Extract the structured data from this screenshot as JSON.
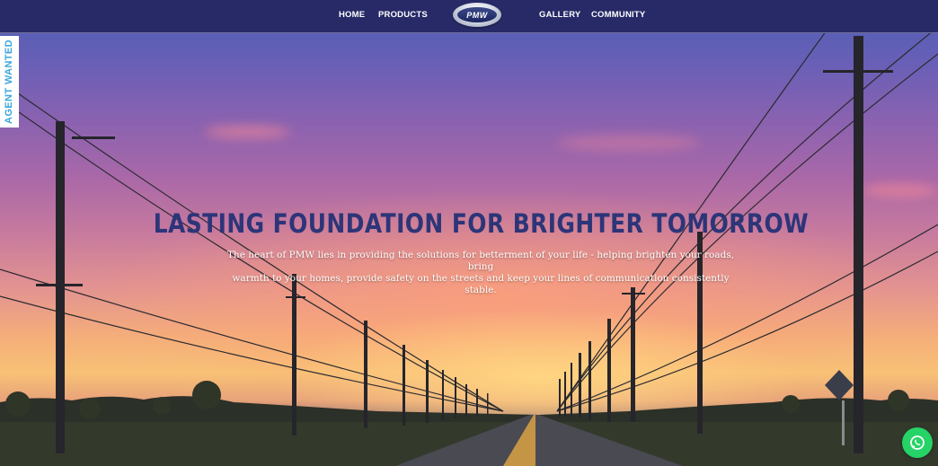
{
  "nav": {
    "home": "HOME",
    "products": "PRODUCTS",
    "logo_text": "PMW",
    "gallery": "GALLERY",
    "community": "COMMUNITY"
  },
  "side_tab": {
    "label": "AGENT WANTED"
  },
  "hero": {
    "headline": "LASTING FOUNDATION FOR BRIGHTER TOMORROW",
    "subtitle_line1": "The heart of PMW lies in providing the solutions for betterment of your life - helping brighten your roads, bring",
    "subtitle_line2": "warmth to your homes, provide safety on the streets and keep your lines of communication consistently stable."
  },
  "icons": {
    "whatsapp": "whatsapp-icon"
  },
  "colors": {
    "nav_bg": "#272a66",
    "headline": "#2d3579",
    "agent_tab_text": "#3aa7dc",
    "whatsapp": "#25d366"
  }
}
